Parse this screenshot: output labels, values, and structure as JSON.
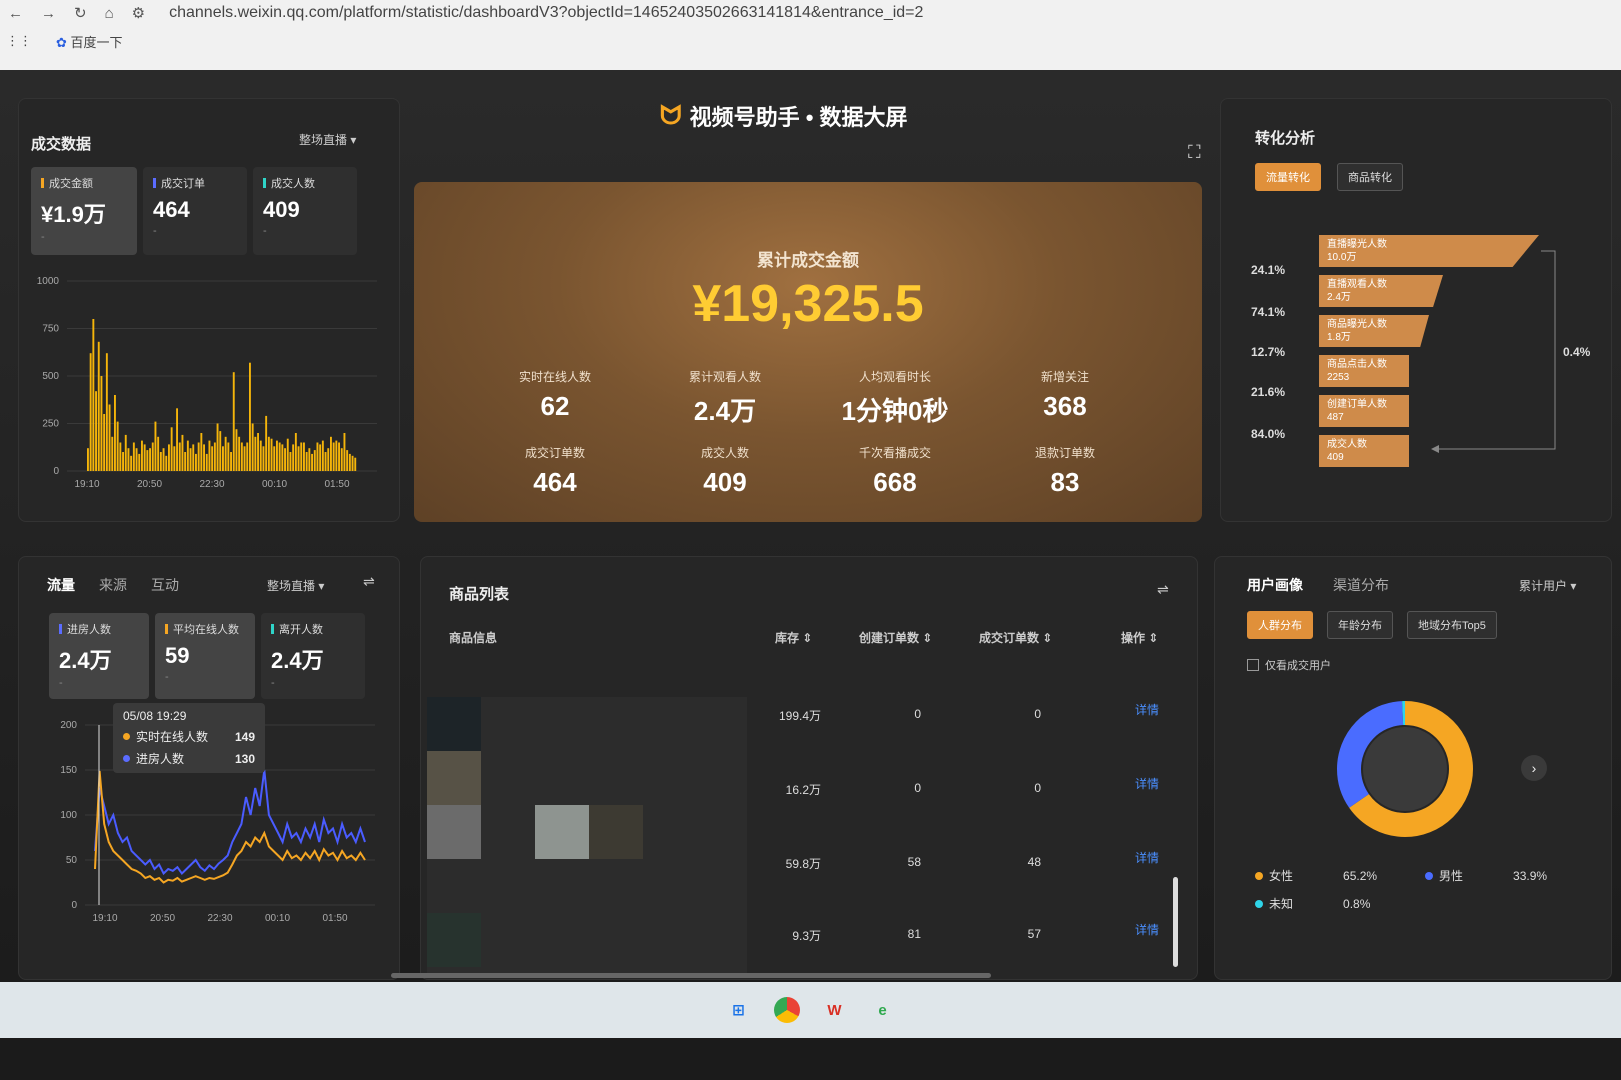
{
  "browser": {
    "url": "channels.weixin.qq.com/platform/statistic/dashboardV3?objectId=14652403502663141814&entrance_id=2",
    "bookmark": "百度一下"
  },
  "header": {
    "title": "视频号助手 • 数据大屏"
  },
  "sales": {
    "title": "成交数据",
    "dropdown": "整场直播 ▾",
    "kpis": [
      {
        "label": "成交金额",
        "value": "¥1.9万",
        "sub": "-",
        "color": "#f5a623"
      },
      {
        "label": "成交订单",
        "value": "464",
        "sub": "-",
        "color": "#5b6cff"
      },
      {
        "label": "成交人数",
        "value": "409",
        "sub": "-",
        "color": "#2fd4c8"
      }
    ],
    "chart_data": {
      "type": "bar",
      "y_ticks": [
        "1000",
        "750",
        "500",
        "250",
        "0"
      ],
      "x_ticks": [
        "19:10",
        "20:50",
        "22:30",
        "00:10",
        "01:50"
      ],
      "ylim": [
        0,
        1000
      ],
      "values": [
        120,
        620,
        800,
        420,
        680,
        500,
        300,
        620,
        350,
        180,
        400,
        260,
        150,
        100,
        190,
        120,
        80,
        150,
        120,
        90,
        160,
        140,
        110,
        120,
        150,
        260,
        180,
        100,
        120,
        80,
        140,
        230,
        130,
        330,
        150,
        190,
        100,
        160,
        120,
        140,
        90,
        150,
        200,
        140,
        90,
        160,
        130,
        150,
        250,
        210,
        130,
        180,
        150,
        100,
        520,
        220,
        180,
        150,
        130,
        150,
        570,
        250,
        180,
        200,
        160,
        130,
        290,
        180,
        170,
        130,
        160,
        150,
        140,
        120,
        170,
        100,
        140,
        200,
        130,
        150,
        150,
        100,
        120,
        90,
        110,
        150,
        140,
        160,
        100,
        120,
        180,
        150,
        160,
        150,
        120,
        200,
        110,
        90,
        80,
        70
      ],
      "color": "#f5b50a"
    }
  },
  "hero": {
    "label": "累计成交金额",
    "value": "¥19,325.5",
    "stats": [
      {
        "label": "实时在线人数",
        "value": "62"
      },
      {
        "label": "累计观看人数",
        "value": "2.4万"
      },
      {
        "label": "人均观看时长",
        "value": "1分钟0秒"
      },
      {
        "label": "新增关注",
        "value": "368"
      },
      {
        "label": "成交订单数",
        "value": "464"
      },
      {
        "label": "成交人数",
        "value": "409"
      },
      {
        "label": "千次看播成交",
        "value": "668"
      },
      {
        "label": "退款订单数",
        "value": "83"
      }
    ]
  },
  "conversion": {
    "title": "转化分析",
    "tabs": [
      "流量转化",
      "商品转化"
    ],
    "steps": [
      {
        "label": "直播曝光人数",
        "value": "10.0万"
      },
      {
        "label": "直播观看人数",
        "value": "2.4万"
      },
      {
        "label": "商品曝光人数",
        "value": "1.8万"
      },
      {
        "label": "商品点击人数",
        "value": "2253"
      },
      {
        "label": "创建订单人数",
        "value": "487"
      },
      {
        "label": "成交人数",
        "value": "409"
      }
    ],
    "rates": [
      "24.1%",
      "74.1%",
      "12.7%",
      "21.6%",
      "84.0%"
    ],
    "overall": "0.4%"
  },
  "traffic": {
    "tabs": [
      "流量",
      "来源",
      "互动"
    ],
    "dropdown": "整场直播 ▾",
    "kpis": [
      {
        "label": "进房人数",
        "value": "2.4万",
        "sub": "-",
        "color": "#5b6cff"
      },
      {
        "label": "平均在线人数",
        "value": "59",
        "sub": "-",
        "color": "#f5a623"
      },
      {
        "label": "离开人数",
        "value": "2.4万",
        "sub": "-",
        "color": "#2fd4c8"
      }
    ],
    "tooltip": {
      "time": "05/08 19:29",
      "rows": [
        {
          "label": "实时在线人数",
          "value": "149",
          "color": "#f5a623"
        },
        {
          "label": "进房人数",
          "value": "130",
          "color": "#5b6cff"
        }
      ]
    },
    "chart_data": {
      "type": "line",
      "y_ticks": [
        "200",
        "150",
        "100",
        "50",
        "0"
      ],
      "x_ticks": [
        "19:10",
        "20:50",
        "22:30",
        "00:10",
        "01:50"
      ],
      "ylim": [
        0,
        200
      ],
      "series": [
        {
          "name": "进房人数",
          "color": "#4a5cff",
          "values": [
            60,
            130,
            110,
            90,
            100,
            80,
            70,
            75,
            60,
            55,
            50,
            45,
            50,
            40,
            45,
            35,
            40,
            38,
            42,
            35,
            40,
            45,
            50,
            42,
            38,
            44,
            40,
            46,
            50,
            55,
            70,
            80,
            90,
            120,
            100,
            130,
            110,
            150,
            100,
            90,
            80,
            70,
            90,
            75,
            80,
            70,
            85,
            75,
            90,
            70,
            95,
            80,
            85,
            70,
            90,
            75,
            80,
            70,
            85,
            70
          ]
        },
        {
          "name": "实时在线人数",
          "color": "#f5a623",
          "values": [
            40,
            149,
            90,
            70,
            60,
            55,
            50,
            45,
            40,
            38,
            35,
            30,
            32,
            28,
            30,
            25,
            28,
            27,
            30,
            26,
            28,
            30,
            32,
            30,
            28,
            30,
            29,
            31,
            33,
            36,
            45,
            55,
            60,
            70,
            65,
            75,
            70,
            80,
            65,
            60,
            55,
            50,
            60,
            52,
            55,
            50,
            58,
            52,
            60,
            50,
            62,
            55,
            58,
            50,
            60,
            52,
            55,
            50,
            58,
            50
          ]
        }
      ]
    }
  },
  "products": {
    "title": "商品列表",
    "headers": {
      "info": "商品信息",
      "stock": "库存 ⇕",
      "created": "创建订单数 ⇕",
      "deals": "成交订单数 ⇕",
      "action": "操作 ⇕"
    },
    "rows": [
      {
        "stock": "199.4万",
        "created": "0",
        "deals": "0",
        "action": "详情"
      },
      {
        "stock": "16.2万",
        "created": "0",
        "deals": "0",
        "action": "详情"
      },
      {
        "stock": "59.8万",
        "created": "58",
        "deals": "48",
        "action": "详情"
      },
      {
        "stock": "9.3万",
        "created": "81",
        "deals": "57",
        "action": "详情"
      }
    ]
  },
  "portrait": {
    "tabs": [
      "用户画像",
      "渠道分布"
    ],
    "dropdown": "累计用户 ▾",
    "subtabs": [
      "人群分布",
      "年龄分布",
      "地域分布Top5"
    ],
    "checkbox": "仅看成交用户",
    "chart_data": {
      "type": "pie",
      "labels": [
        "女性",
        "男性",
        "未知"
      ],
      "values": [
        65.2,
        33.9,
        0.8
      ],
      "colors": [
        "#f5a623",
        "#4a6cff",
        "#2fd4e8"
      ]
    },
    "legend": [
      {
        "label": "女性",
        "value": "65.2%",
        "color": "#f5a623"
      },
      {
        "label": "男性",
        "value": "33.9%",
        "color": "#4a6cff"
      },
      {
        "label": "未知",
        "value": "0.8%",
        "color": "#2fd4e8"
      }
    ]
  }
}
